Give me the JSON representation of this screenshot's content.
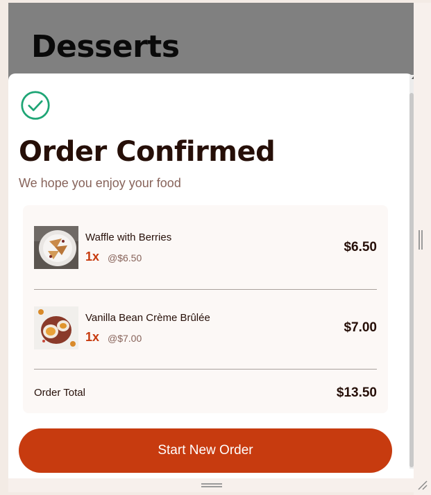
{
  "page": {
    "background_title": "Desserts"
  },
  "modal": {
    "title": "Order Confirmed",
    "subtitle": "We hope you enjoy your food",
    "icon": "check-circle-icon",
    "items": [
      {
        "name": "Waffle with Berries",
        "quantity": "1x",
        "unit_price": "@$6.50",
        "total": "$6.50",
        "thumbnail": "waffle-thumbnail"
      },
      {
        "name": "Vanilla Bean Crème Brûlée",
        "quantity": "1x",
        "unit_price": "@$7.00",
        "total": "$7.00",
        "thumbnail": "creme-brulee-thumbnail"
      }
    ],
    "order_total_label": "Order Total",
    "order_total_value": "$13.50",
    "button_label": "Start New Order"
  },
  "colors": {
    "accent": "#c73b0f",
    "success": "#1ea575",
    "text_dark": "#260f08",
    "text_muted": "#87635a",
    "overlay": "#808080",
    "card_bg": "#fcf8f6"
  }
}
